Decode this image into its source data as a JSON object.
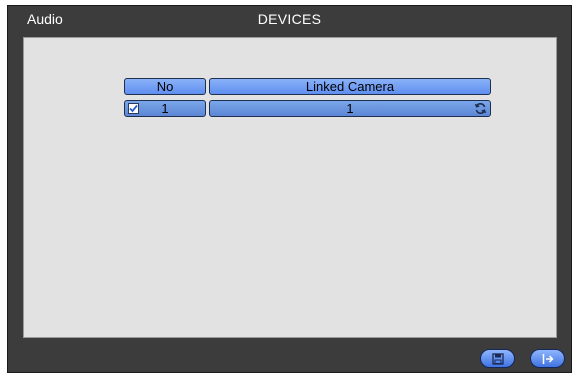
{
  "header": {
    "section_name": "Audio",
    "title": "DEVICES"
  },
  "table": {
    "columns": [
      "No",
      "Linked Camera"
    ],
    "rows": [
      {
        "checked": true,
        "no": "1",
        "linked_camera": "1"
      }
    ]
  },
  "footer": {
    "buttons": [
      {
        "icon": "save-icon"
      },
      {
        "icon": "exit-icon"
      }
    ]
  },
  "colors": {
    "window_bg": "#3c3c3c",
    "panel_bg": "#e2e2e2",
    "header_cell": "#6f9df5",
    "body_cell": "#6b97df",
    "button": "#5a8cf0"
  }
}
